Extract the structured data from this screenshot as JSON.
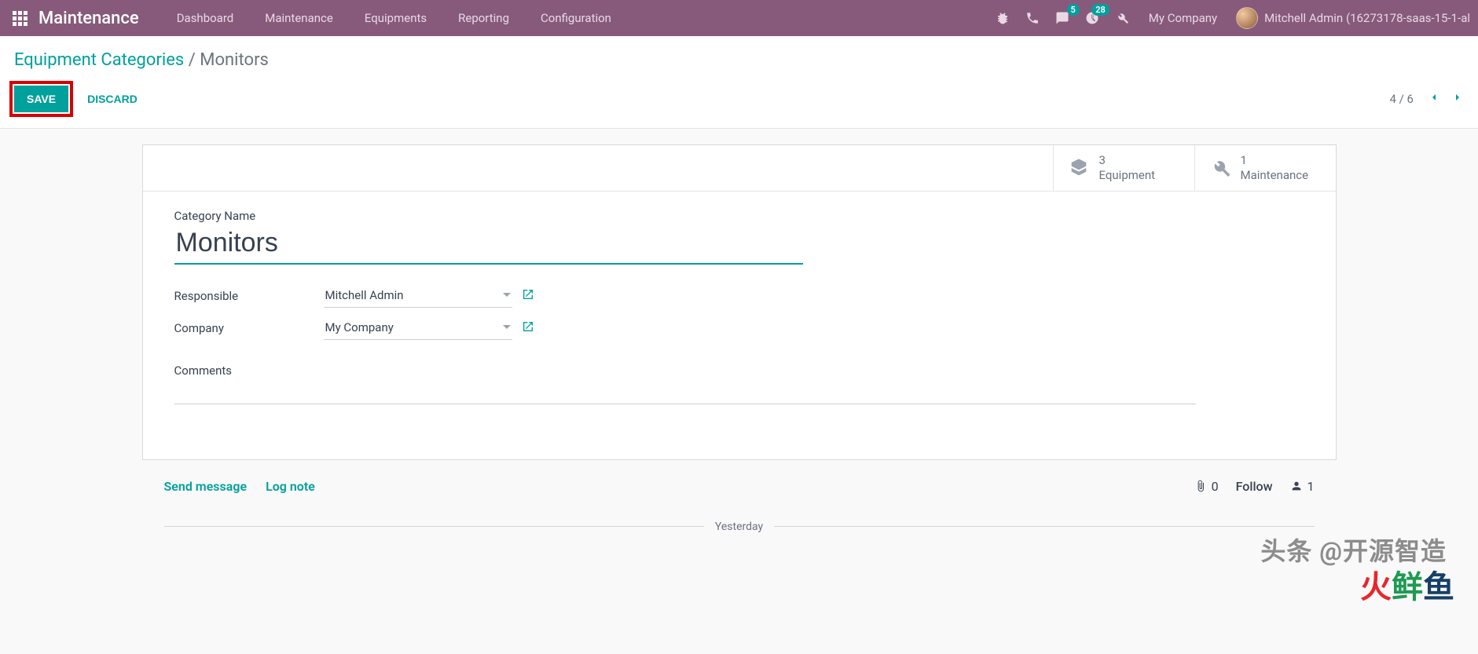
{
  "nav": {
    "brand": "Maintenance",
    "items": [
      "Dashboard",
      "Maintenance",
      "Equipments",
      "Reporting",
      "Configuration"
    ],
    "messaging_badge": "5",
    "activities_badge": "28",
    "company": "My Company",
    "user": "Mitchell Admin (16273178-saas-15-1-al"
  },
  "breadcrumb": {
    "parent": "Equipment Categories",
    "sep": " / ",
    "current": "Monitors"
  },
  "buttons": {
    "save": "SAVE",
    "discard": "DISCARD"
  },
  "pager": {
    "text": "4 / 6"
  },
  "stat": {
    "equipment_count": "3",
    "equipment_label": "Equipment",
    "maintenance_count": "1",
    "maintenance_label": "Maintenance"
  },
  "form": {
    "category_name_label": "Category Name",
    "category_name_value": "Monitors",
    "responsible_label": "Responsible",
    "responsible_value": "Mitchell Admin",
    "company_label": "Company",
    "company_value": "My Company",
    "comments_label": "Comments"
  },
  "chatter": {
    "send": "Send message",
    "log": "Log note",
    "attachments": "0",
    "follow": "Follow",
    "followers": "1",
    "date_sep": "Yesterday"
  },
  "watermark1": "头条 @开源智造",
  "watermark2": {
    "a": "火",
    "b": "鲜",
    "c": "鱼"
  }
}
